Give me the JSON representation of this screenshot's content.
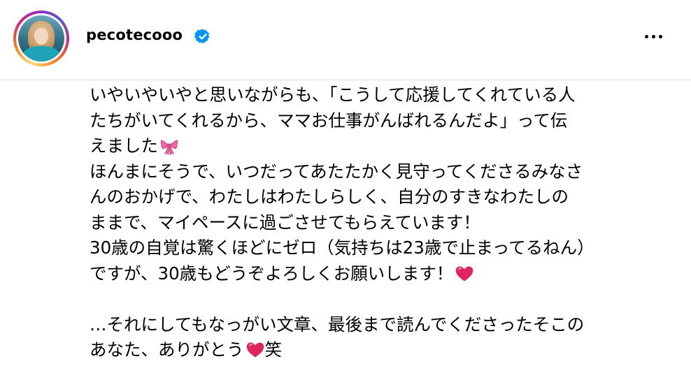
{
  "post": {
    "username": "pecotecooo",
    "verified_icon": "verified-badge-icon",
    "more_icon": "more-options-icon"
  },
  "caption": {
    "l1": "いやいやいやと思いながらも、「こうして応援してくれている人",
    "l2": "たちがいてくれるから、ママお仕事がんばれるんだよ」って伝",
    "l3": "えました",
    "l4": "ほんまにそうで、いつだってあたたかく見守ってくださるみなさ",
    "l5": "んのおかげで、わたしはわたしらしく、自分のすきなわたしの",
    "l6": "ままで、マイペースに過ごさせてもらえています！",
    "l7": "30歳の自覚は驚くほどにゼロ（気持ちは23歳で止まってるねん）",
    "l8": "ですが、30歳もどうぞよろしくお願いします！",
    "l10": "…それにしてもなっがい文章、最後まで読んでくださったそこの",
    "l11a": "あなた、ありがとう",
    "l11b": "笑"
  },
  "icons": {
    "ribbon": "ribbon-emoji-icon",
    "heart": "heart-emoji-icon"
  },
  "colors": {
    "verified": "#0095f6",
    "divider": "#dbdbdb",
    "ribbon": "#f06aa0",
    "heart": "#e0245e"
  }
}
